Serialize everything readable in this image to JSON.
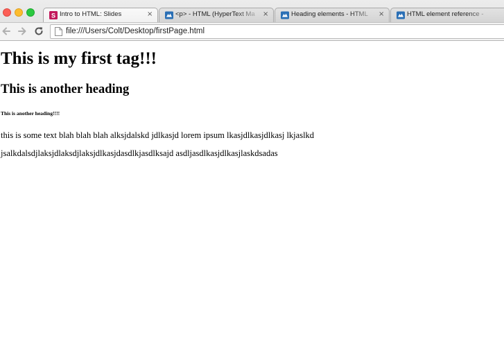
{
  "browser": {
    "tabs": [
      {
        "label": "Intro to HTML: Slides",
        "favicon": "slides-favicon",
        "active": true,
        "close": "×"
      },
      {
        "label": "<p> - HTML (HyperText Ma",
        "favicon": "mdn-favicon",
        "active": false,
        "close": "×"
      },
      {
        "label": "Heading elements - HTML",
        "favicon": "mdn-favicon",
        "active": false,
        "close": "×"
      },
      {
        "label": "HTML element reference -",
        "favicon": "mdn-favicon",
        "active": false
      }
    ],
    "url": "file:///Users/Colt/Desktop/firstPage.html",
    "colors": {
      "slides_favicon": "#c2185b",
      "mdn_favicon": "#2a6fb5"
    }
  },
  "page": {
    "h1": "This is my first tag!!!",
    "h2": "This is another heading",
    "h6": "This is another heading!!!!",
    "paragraphs": [
      "this is some text blah blah blah alksjdalskd jdlkasjd lorem ipsum lkasjdlkasjdlkasj lkjaslkd",
      "jsalkdalsdjlaksjdlaksdjlaksjdlkasjdasdlkjasdlksajd asdljasdlkasjdlkasjlaskdsadas"
    ]
  }
}
